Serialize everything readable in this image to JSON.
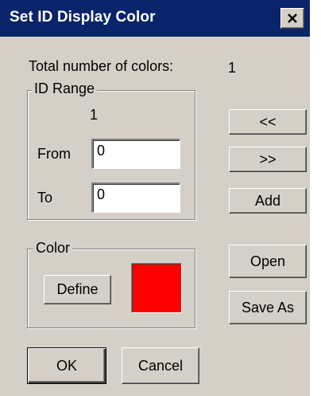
{
  "window": {
    "title": "Set ID Display Color",
    "close_icon": "close-icon"
  },
  "total_colors": {
    "label": "Total number of colors:",
    "value": "1"
  },
  "id_range": {
    "title": "ID Range",
    "index": "1",
    "from_label": "From",
    "from_value": "0",
    "to_label": "To",
    "to_value": "0"
  },
  "nav": {
    "prev_label": "<<",
    "next_label": ">>",
    "add_label": "Add"
  },
  "color": {
    "title": "Color",
    "define_label": "Define",
    "swatch_color": "#ff0000"
  },
  "file": {
    "open_label": "Open",
    "save_as_label": "Save As"
  },
  "footer": {
    "ok_label": "OK",
    "cancel_label": "Cancel"
  }
}
